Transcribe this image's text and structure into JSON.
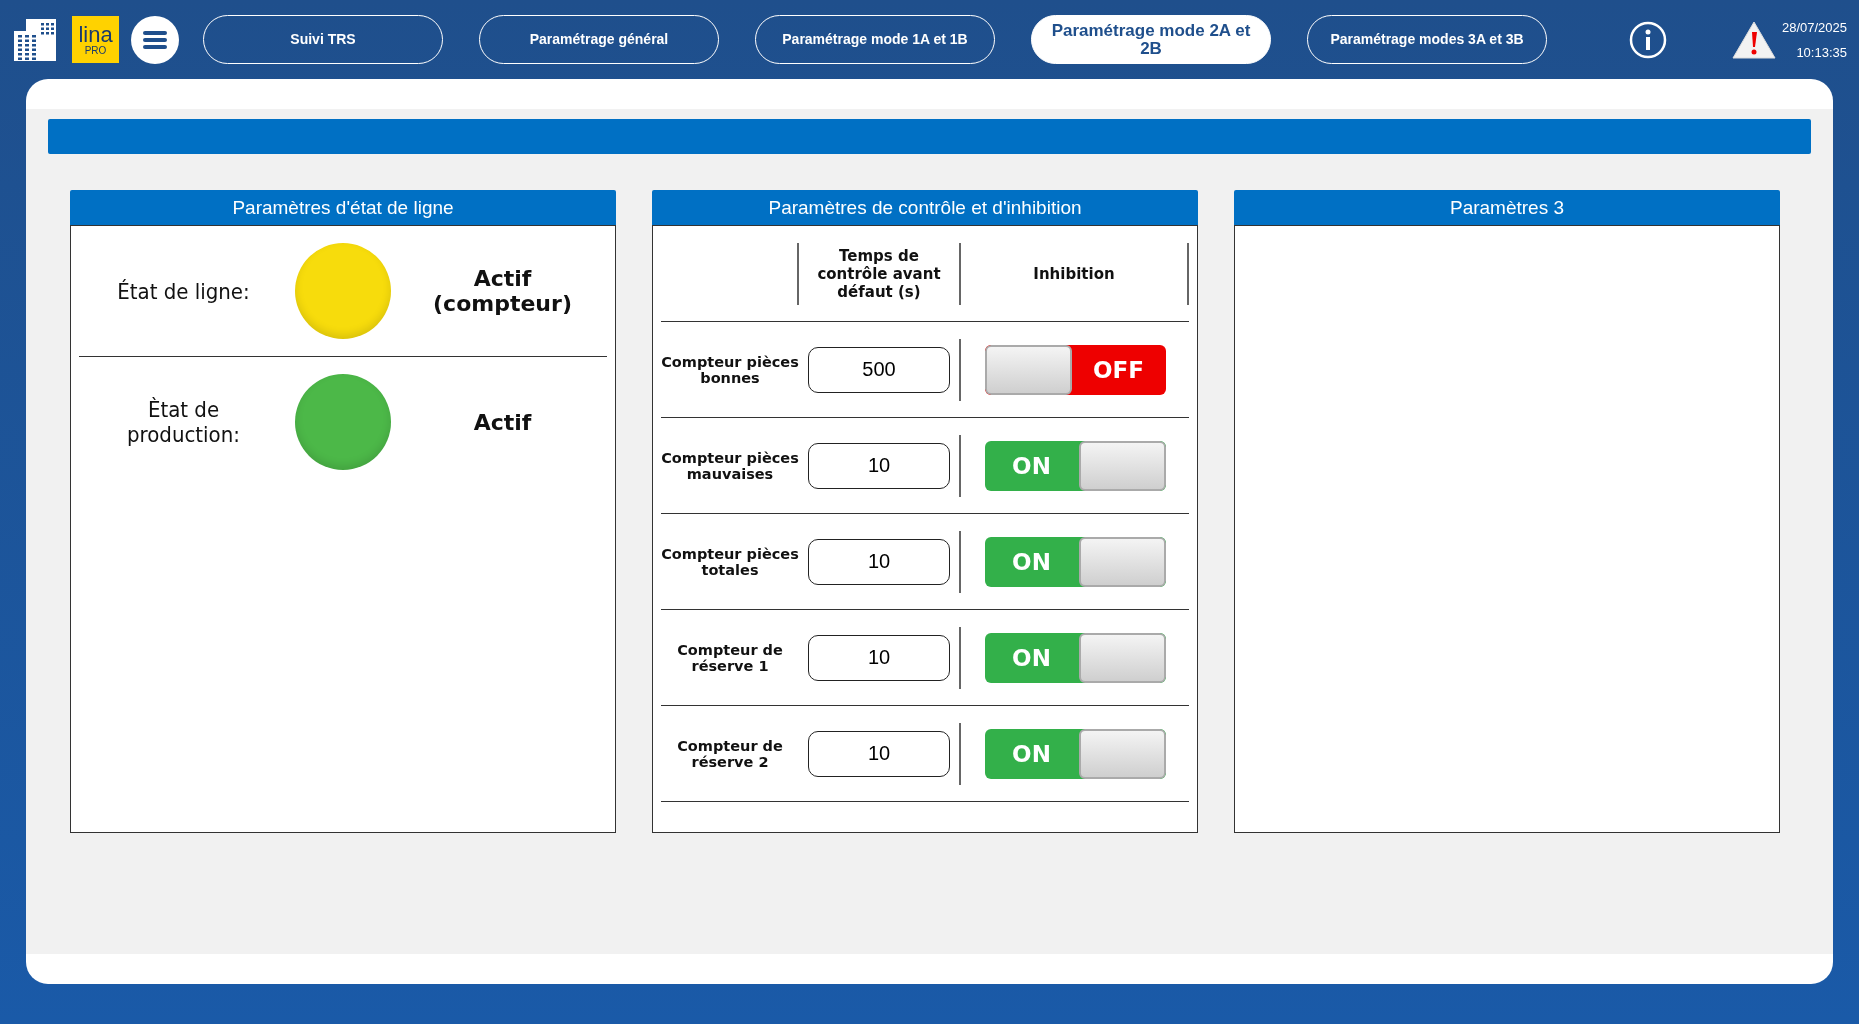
{
  "nav": {
    "tabs": [
      {
        "label": "Suivi TRS",
        "selected": false
      },
      {
        "label": "Paramétrage général",
        "selected": false
      },
      {
        "label": "Paramétrage mode 1A et 1B",
        "selected": false
      },
      {
        "label": "Paramétrage mode 2A et 2B",
        "selected": true
      },
      {
        "label": "Paramétrage modes 3A et 3B",
        "selected": false
      }
    ],
    "logo": {
      "line1": "lina",
      "line2": "PRO"
    },
    "date": "28/07/2025",
    "time": "10:13:35"
  },
  "line_state_panel": {
    "title": "Paramètres d'état de ligne",
    "rows": [
      {
        "label": "État de ligne:",
        "color": "#f7dc0c",
        "value": "Actif (compteur)"
      },
      {
        "label": "Ètat de production:",
        "color": "#4cb848",
        "value": "Actif"
      }
    ]
  },
  "control_panel": {
    "title": "Paramètres de contrôle et d'inhibition",
    "columns": [
      "Temps de contrôle avant défaut (s)",
      "Inhibition"
    ],
    "rows": [
      {
        "label": "Compteur pièces bonnes",
        "value": "500",
        "inhibition": {
          "on": false,
          "label": "OFF"
        }
      },
      {
        "label": "Compteur pièces mauvaises",
        "value": "10",
        "inhibition": {
          "on": true,
          "label": "ON"
        }
      },
      {
        "label": "Compteur pièces totales",
        "value": "10",
        "inhibition": {
          "on": true,
          "label": "ON"
        }
      },
      {
        "label": "Compteur de réserve 1",
        "value": "10",
        "inhibition": {
          "on": true,
          "label": "ON"
        }
      },
      {
        "label": "Compteur de réserve 2",
        "value": "10",
        "inhibition": {
          "on": true,
          "label": "ON"
        }
      }
    ]
  },
  "params3_panel": {
    "title": "Paramètres 3"
  }
}
